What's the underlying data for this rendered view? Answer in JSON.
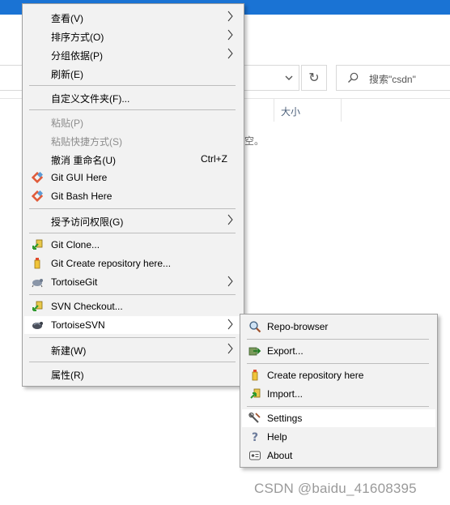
{
  "explorer": {
    "search_placeholder": "搜索\"csdn\"",
    "column_size": "大小",
    "empty_text": "为空。",
    "accent_color": "#1a73d4"
  },
  "main_menu": {
    "items": [
      {
        "label": "查看(V)",
        "submenu": true
      },
      {
        "label": "排序方式(O)",
        "submenu": true
      },
      {
        "label": "分组依据(P)",
        "submenu": true
      },
      {
        "label": "刷新(E)"
      },
      {
        "label": "自定义文件夹(F)..."
      },
      {
        "label": "粘贴(P)",
        "disabled": true
      },
      {
        "label": "粘贴快捷方式(S)",
        "disabled": true
      },
      {
        "label": "撤消 重命名(U)",
        "accelerator": "Ctrl+Z"
      },
      {
        "label": "Git GUI Here",
        "icon": "git-icon"
      },
      {
        "label": "Git Bash Here",
        "icon": "git-icon"
      },
      {
        "label": "授予访问权限(G)",
        "submenu": true
      },
      {
        "label": "Git Clone...",
        "icon": "git-clone-icon"
      },
      {
        "label": "Git Create repository here...",
        "icon": "create-repo-icon"
      },
      {
        "label": "TortoiseGit",
        "icon": "tortoisegit-icon",
        "submenu": true
      },
      {
        "label": "SVN Checkout...",
        "icon": "svn-checkout-icon"
      },
      {
        "label": "TortoiseSVN",
        "icon": "tortoisesvn-icon",
        "submenu": true,
        "highlighted": true
      },
      {
        "label": "新建(W)",
        "submenu": true
      },
      {
        "label": "属性(R)"
      }
    ]
  },
  "svn_submenu": {
    "items": [
      {
        "label": "Repo-browser",
        "icon": "repo-browser-icon"
      },
      {
        "label": "Export...",
        "icon": "export-icon"
      },
      {
        "label": "Create repository here",
        "icon": "create-repo-icon"
      },
      {
        "label": "Import...",
        "icon": "import-icon"
      },
      {
        "label": "Settings",
        "icon": "settings-icon",
        "highlighted": true
      },
      {
        "label": "Help",
        "icon": "help-icon"
      },
      {
        "label": "About",
        "icon": "about-icon"
      }
    ]
  },
  "watermark": "CSDN @baidu_41608395"
}
